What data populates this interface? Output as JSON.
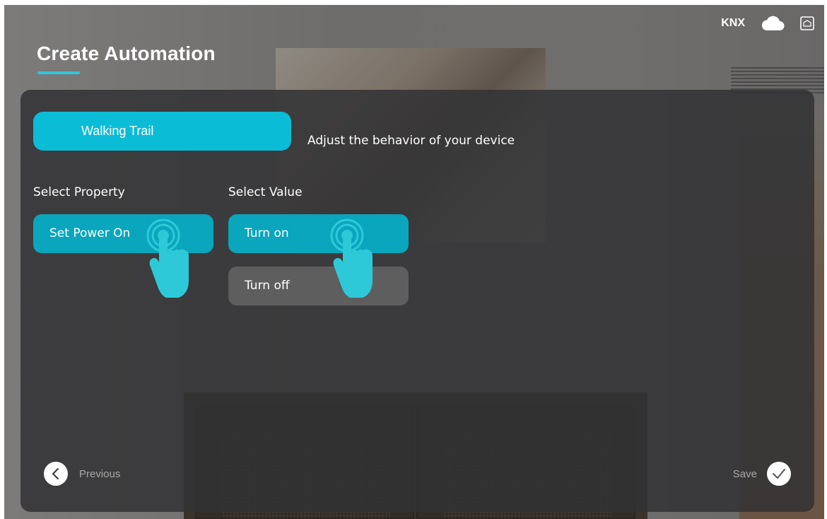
{
  "status_bar": {
    "protocol_label": "KNX",
    "icons": [
      "cloud-icon",
      "home-icon"
    ]
  },
  "header": {
    "title": "Create Automation"
  },
  "device": {
    "name": "Walking Trail",
    "instruction": "Adjust the behavior of your device"
  },
  "property_column": {
    "label": "Select Property",
    "options": [
      {
        "label": "Set Power On",
        "selected": true
      }
    ]
  },
  "value_column": {
    "label": "Select Value",
    "options": [
      {
        "label": "Turn on",
        "selected": true
      },
      {
        "label": "Turn off",
        "selected": false
      }
    ]
  },
  "footer": {
    "previous_label": "Previous",
    "save_label": "Save"
  },
  "colors": {
    "accent": "#0bbcd6",
    "selected_option": "#0aa6bd",
    "unselected_option": "#5e5e5e",
    "panel": "#323234"
  }
}
